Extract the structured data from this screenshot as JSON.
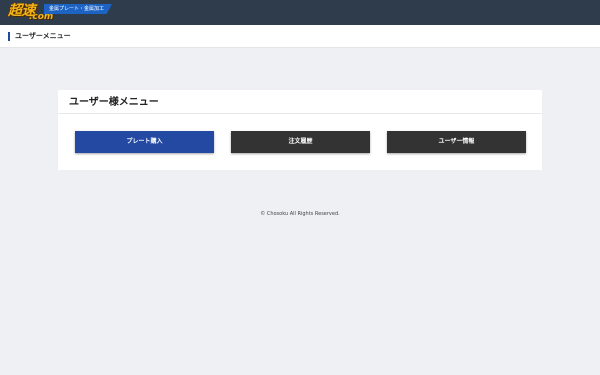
{
  "header": {
    "logo_main": "超速",
    "logo_dotcom": ".com",
    "logo_tagline": "金属プレート・金属加工",
    "colors": {
      "bar": "#2e3c4b",
      "logo": "#f3b417",
      "tagline_bg": "#1d63c4"
    }
  },
  "page": {
    "heading": "ユーザーメニュー",
    "accent_color": "#2249a0"
  },
  "menu": {
    "title": "ユーザー様メニュー",
    "buttons": [
      {
        "label": "プレート購入",
        "color": "#2349a2"
      },
      {
        "label": "注文履歴",
        "color": "#333333"
      },
      {
        "label": "ユーザー情報",
        "color": "#333333"
      }
    ]
  },
  "footer": {
    "copyright": "© Chosoku All Rights Reserved."
  }
}
